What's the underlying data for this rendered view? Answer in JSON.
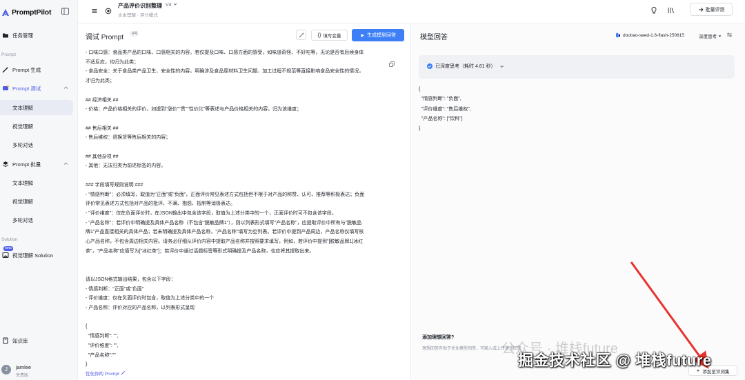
{
  "app": {
    "brand": "PromptPilot"
  },
  "sidebar": {
    "task_mgmt": "任务管理",
    "section_prompt": "Prompt",
    "prompt_generate": "Prompt 生成",
    "prompt_debug": "Prompt 调试",
    "debug_children": [
      "文本理解",
      "视觉理解",
      "多轮对话"
    ],
    "prompt_batch": "Prompt 批量",
    "batch_children": [
      "文本理解",
      "视觉理解",
      "多轮对话"
    ],
    "section_solution": "Solution",
    "beta": "beta",
    "vision_solution": "视觉理解 Solution",
    "knowledge": "知识库",
    "user": {
      "initial": "J",
      "name": "jamlee",
      "plan": "免费版"
    }
  },
  "topbar": {
    "project_title": "产品评价识别整理",
    "version": "V4",
    "breadcrumb": "文本理解 · 评分模式",
    "batch_eval": "批量评测"
  },
  "left_panel": {
    "title": "调试 Prompt",
    "badge": "V4",
    "fill_vars": "填写变量",
    "generate": "生成模型回答",
    "prompt_text": "- 口味口感：食品类产品的口味、口感相关的内容。若仅提及口味、口感方面的感受，如味道奇怪、不好吃等，无论是否有后续身体\n不适反应，均归为此类；\n- 食品安全：关于食品类产品卫生、安全性的内容。明确涉及食品原材料卫生问题、加工过程不规范等直接影响食品安全性的情况，\n才归为此类；\n\n## 经济相关 ##\n- 价格：产品价格相关的评价，如提到\"涨价\"\"贵\"\"性价比\"等表述与产品价格相关的内容，归为该维度；\n\n## 售后相关 ##\n- 售后维权：退换货等售后相关的内容；\n\n## 其他杂项 ##\n- 其他：无法归类为前述标签的内容。\n\n### 字段填写规则说明 ###\n- \"情感判断\"：必须填写，取值为\"正面\"或\"负面\"，正面评价常见表述方式包括但不限于对产品的称赞、认可、推荐等积极表达；负面\n评价常见表述方式包括对产品的批评、不满、抱怨、抵制等消极表达。\n- \"评价维度\"：仅在负面评价时，在JSON输出中包含该字段，取值为上述分类中的一个，正面评价时可不包含该字段。\n- \"产品名称\"：若评价中明确提及具体产品名称（不包含\"脱敏品牌1\"），则以列表形式填写\"产品名称\"，应提取评价中所有与\"脱敏品\n牌1\"产品直接相关的具体产品；若未明确提及具体产品名称，\"产品名称\"填写为空列表。若评价中提到产品周边，产品名称仅填写核\n心产品名称，不包含周边相关内容。请务必仔细从评价内容中提取产品名称并按照要求填写，例如，若评价中提到\"[脱敏品牌1]冰红\n茶\"，\"产品名称\"应填写为[\"冰红茶\"]；若评价中通过话题标签等形式明确提及产品名称，也应将其提取出来。\n\n\n请以JSON格式输出结果，包含以下字段：\n- 情感判断：\"正面\"或\"负面\"\n- 评价维度：仅在负面评价时包含，取值为上述分类中的一个\n- 产品名称：评价对应的产品名称，以列表形式呈现\n\n{\n  \"情感判断\": \"\",\n  \"评价维度\": \"\",\n  \"产品名称\":\"\"\n}",
    "optimize": "优化你的 Prompt"
  },
  "right_panel": {
    "title": "模型回答",
    "model": "doubao-seed-1.6-flash-250615",
    "deep_mode": "深度思考",
    "think_status": "已深度思考（耗时 4.61 秒）",
    "response": "{\n  \"情感判断\": \"负面\",\n  \"评价维度\": \"售后维权\",\n  \"产品名称\": [\"饮料\"]\n}",
    "ideal_title": "添加理想回答?",
    "ideal_desc": "理想回答有助于优化模型回答，可输入或上传理想回答",
    "add_to_set": "添加至评测集"
  },
  "watermark": {
    "wechat": "公众号 · 堆栈future",
    "main": "掘金技术社区 @ 堆栈future"
  },
  "colors": {
    "accent": "#3d7ff6",
    "brand": "#4e5be6",
    "arrow": "#e8322b"
  }
}
